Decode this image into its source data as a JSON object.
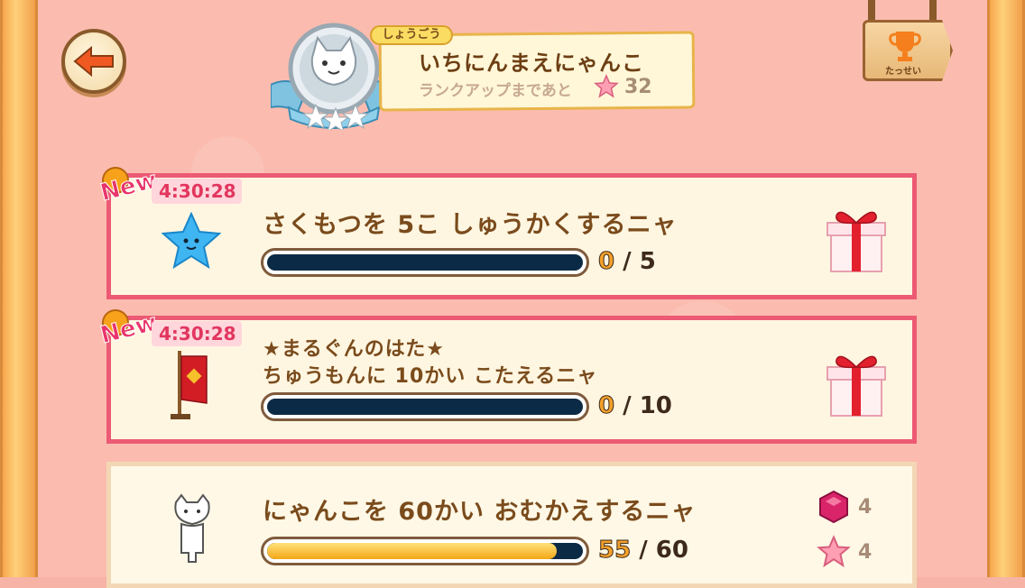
{
  "header": {
    "title_tag": "しょうごう",
    "rank_title": "いちにんまえにゃんこ",
    "rank_up_label": "ランクアップまであと",
    "rank_up_count": "32",
    "achievements_label": "たっせい"
  },
  "missions": [
    {
      "new_label": "New",
      "timer": "4:30:28",
      "text": "さくもつを 5こ しゅうかくするニャ",
      "current": "0",
      "target": "5",
      "progress_fraction": 0,
      "icon": "blue-star-icon",
      "reward": "gift-box-icon"
    },
    {
      "new_label": "New",
      "timer": "4:30:28",
      "text_line1": "★まるぐんのはた★",
      "text_line2": "ちゅうもんに 10かい こたえるニャ",
      "current": "0",
      "target": "10",
      "progress_fraction": 0,
      "icon": "banner-flag-icon",
      "reward": "gift-box-icon"
    },
    {
      "text": "にゃんこを 60かい おむかえするニャ",
      "current": "55",
      "target": "60",
      "progress_fraction": 0.9167,
      "icon": "white-cat-icon",
      "rewards": [
        {
          "icon": "gem-icon",
          "amount": "4"
        },
        {
          "icon": "pink-star-icon",
          "amount": "4"
        }
      ]
    }
  ],
  "colors": {
    "accent_pink": "#ec5a74",
    "text_brown": "#7a4b1c",
    "bar_dark": "#0b2a45",
    "bar_fill": "#f3a717"
  }
}
